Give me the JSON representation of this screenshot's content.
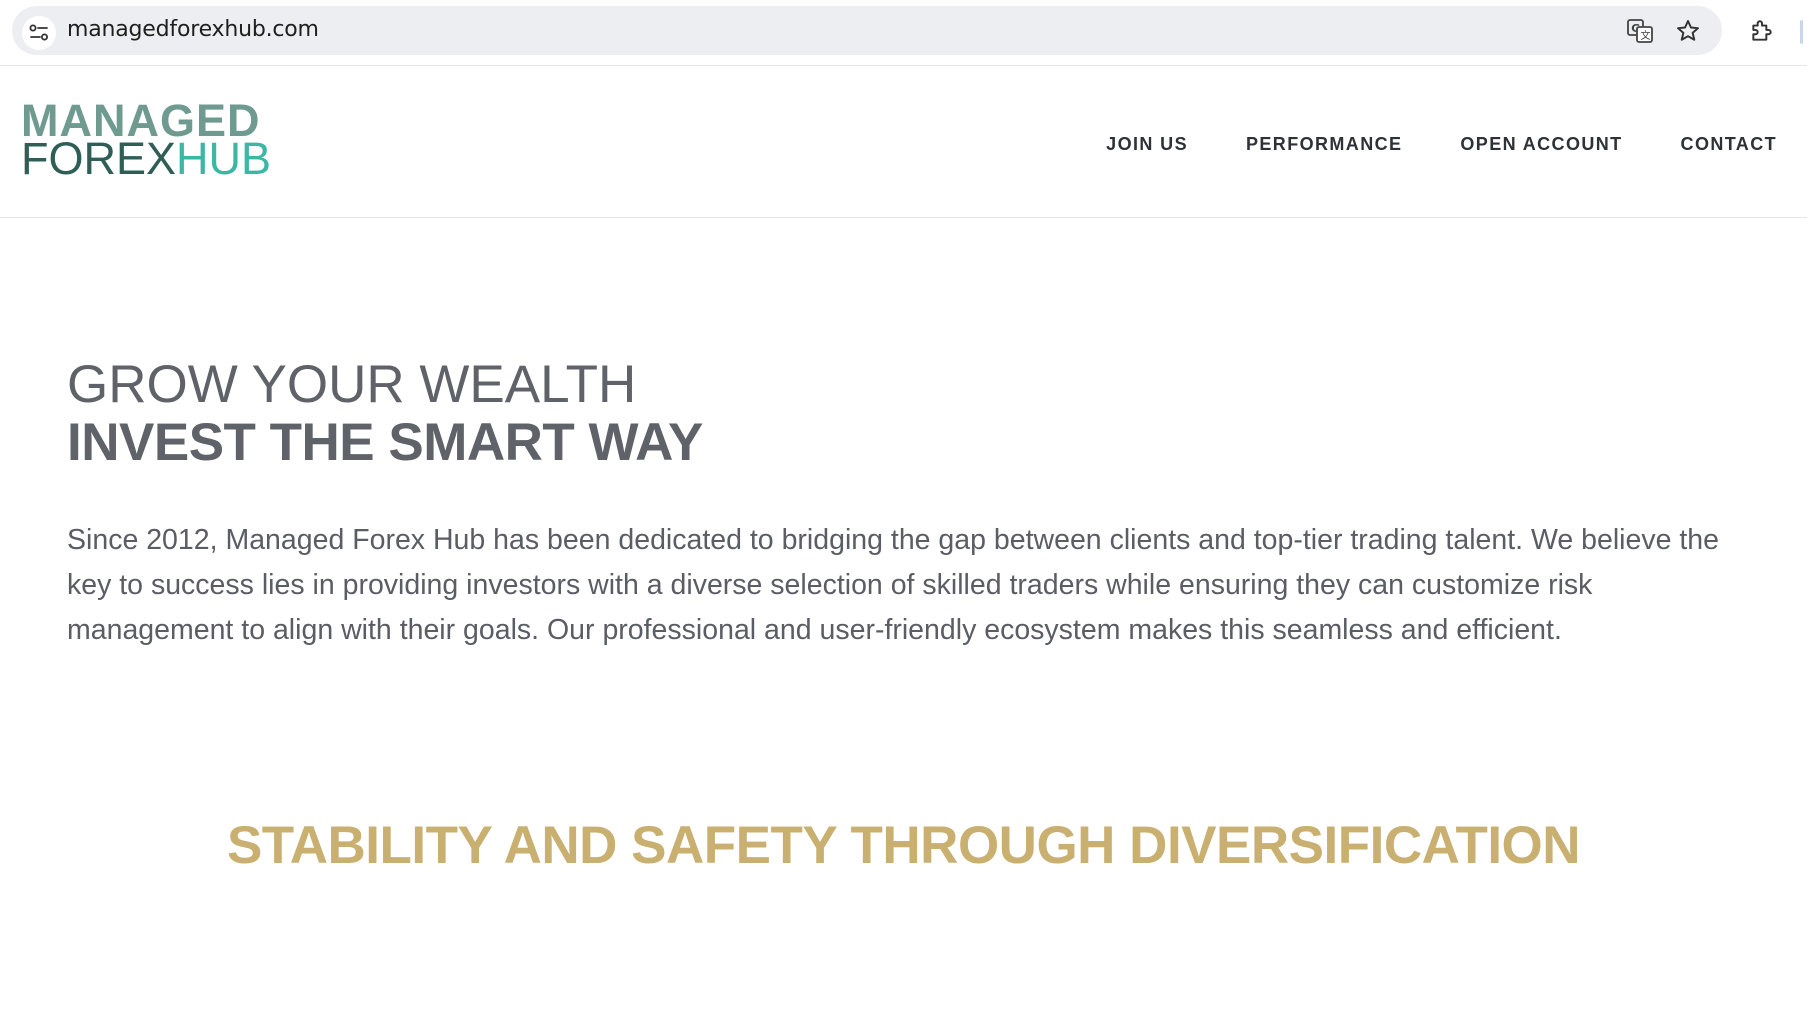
{
  "browser": {
    "url": "managedforexhub.com",
    "icons": [
      "site-info-icon",
      "translate-icon",
      "star-icon",
      "extensions-icon"
    ]
  },
  "header": {
    "logo": {
      "top": "MANAGED",
      "bottom_left": "FOREX",
      "bottom_right": "HUB"
    },
    "nav": [
      {
        "label": "JOIN US"
      },
      {
        "label": "PERFORMANCE"
      },
      {
        "label": "OPEN ACCOUNT"
      },
      {
        "label": "CONTACT"
      }
    ]
  },
  "hero": {
    "line1": "GROW YOUR WEALTH",
    "line2": "INVEST THE SMART WAY",
    "paragraph": "Since 2012, Managed Forex Hub has been dedicated to bridging the gap between clients and top-tier trading talent. We believe the key to success lies in providing investors with a diverse selection of skilled traders while ensuring they can customize risk management to align with their goals. Our professional and user-friendly ecosystem makes this seamless and efficient."
  },
  "section": {
    "heading": "STABILITY AND SAFETY THROUGH DIVERSIFICATION"
  },
  "colors": {
    "logo_top": "#6e9a90",
    "logo_forex": "#2f5e57",
    "logo_hub": "#3bb7a3",
    "heading_gray": "#5f6268",
    "accent_gold": "#c9b071"
  }
}
